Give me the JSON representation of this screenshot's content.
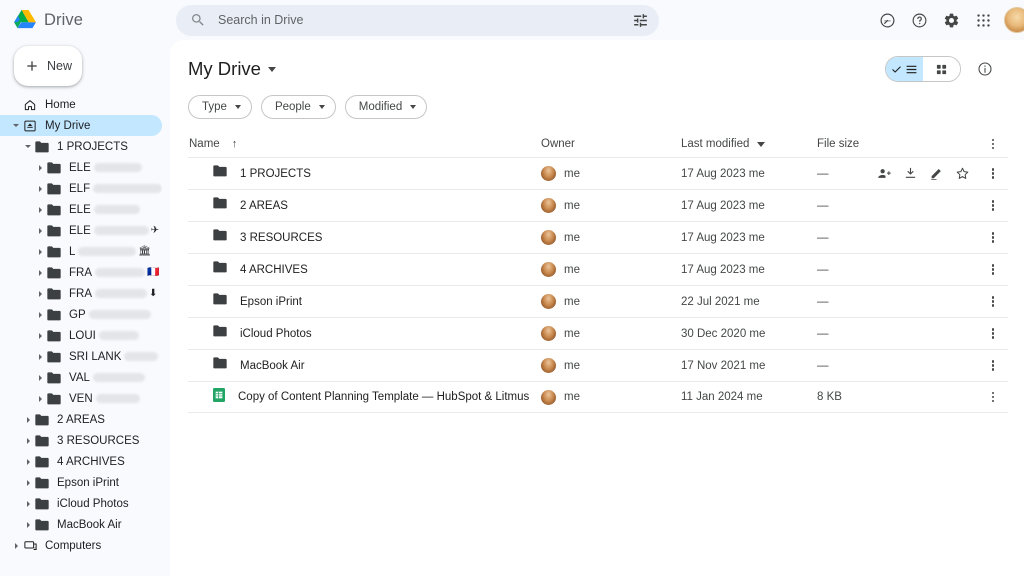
{
  "app": {
    "brand": "Drive",
    "logo_colors": [
      "#0da960",
      "#2684fc",
      "#ffc107"
    ]
  },
  "search": {
    "placeholder": "Search in Drive",
    "value": "",
    "tune_icon": "tune-icon",
    "icon": "search-icon"
  },
  "topbar_icons": [
    {
      "name": "activity-icon",
      "label": "Activity"
    },
    {
      "name": "help-icon",
      "label": "Support"
    },
    {
      "name": "settings-gear-icon",
      "label": "Settings"
    },
    {
      "name": "apps-grid-icon",
      "label": "Google apps"
    }
  ],
  "sidebar": {
    "new_button": "New",
    "items": [
      {
        "label": "Home",
        "icon": "home-icon",
        "depth": 0,
        "twisty": "none",
        "active": false
      },
      {
        "label": "My Drive",
        "icon": "my-drive-icon",
        "depth": 0,
        "twisty": "open",
        "active": true
      },
      {
        "label": "1 PROJECTS",
        "icon": "folder-icon",
        "depth": 1,
        "twisty": "open",
        "active": false
      },
      {
        "label": "ELE",
        "icon": "folder-icon",
        "depth": 2,
        "twisty": "closed",
        "active": false,
        "redact": 48
      },
      {
        "label": "ELF",
        "icon": "folder-icon",
        "depth": 2,
        "twisty": "closed",
        "active": false,
        "redact": 70
      },
      {
        "label": "ELE",
        "icon": "folder-icon",
        "depth": 2,
        "twisty": "closed",
        "active": false,
        "redact": 46
      },
      {
        "label": "ELE",
        "icon": "folder-icon",
        "depth": 2,
        "twisty": "closed",
        "active": false,
        "redact": 55,
        "emoji": "✈"
      },
      {
        "label": "L",
        "icon": "folder-icon",
        "depth": 2,
        "twisty": "closed",
        "active": false,
        "redact": 58,
        "emoji": "🏛"
      },
      {
        "label": "FRA",
        "icon": "folder-icon",
        "depth": 2,
        "twisty": "closed",
        "active": false,
        "redact": 50,
        "emoji": "🇫🇷"
      },
      {
        "label": "FRA",
        "icon": "folder-icon",
        "depth": 2,
        "twisty": "closed",
        "active": false,
        "redact": 52,
        "emoji": "⬇"
      },
      {
        "label": "GP",
        "icon": "folder-icon",
        "depth": 2,
        "twisty": "closed",
        "active": false,
        "redact": 62
      },
      {
        "label": "LOUI",
        "icon": "folder-icon",
        "depth": 2,
        "twisty": "closed",
        "active": false,
        "redact": 40
      },
      {
        "label": "SRI LANK",
        "icon": "folder-icon",
        "depth": 2,
        "twisty": "closed",
        "active": false,
        "redact": 34
      },
      {
        "label": "VAL",
        "icon": "folder-icon",
        "depth": 2,
        "twisty": "closed",
        "active": false,
        "redact": 52
      },
      {
        "label": "VEN",
        "icon": "folder-icon",
        "depth": 2,
        "twisty": "closed",
        "active": false,
        "redact": 44
      },
      {
        "label": "2 AREAS",
        "icon": "folder-icon",
        "depth": 1,
        "twisty": "closed",
        "active": false
      },
      {
        "label": "3 RESOURCES",
        "icon": "folder-icon",
        "depth": 1,
        "twisty": "closed",
        "active": false
      },
      {
        "label": "4 ARCHIVES",
        "icon": "folder-icon",
        "depth": 1,
        "twisty": "closed",
        "active": false
      },
      {
        "label": "Epson iPrint",
        "icon": "folder-icon",
        "depth": 1,
        "twisty": "closed",
        "active": false
      },
      {
        "label": "iCloud Photos",
        "icon": "folder-icon",
        "depth": 1,
        "twisty": "closed",
        "active": false
      },
      {
        "label": "MacBook Air",
        "icon": "folder-icon",
        "depth": 1,
        "twisty": "closed",
        "active": false
      },
      {
        "label": "Computers",
        "icon": "computers-icon",
        "depth": 0,
        "twisty": "closed",
        "active": false
      }
    ]
  },
  "main": {
    "title": "My Drive",
    "filters": [
      {
        "label": "Type",
        "name": "filter-type"
      },
      {
        "label": "People",
        "name": "filter-people"
      },
      {
        "label": "Modified",
        "name": "filter-modified"
      }
    ],
    "view": {
      "list_active": true,
      "list_name": "list-view-button",
      "grid_name": "grid-view-button",
      "info_name": "details-info-button"
    },
    "columns": {
      "name": "Name",
      "sort_indicator": "↑",
      "owner": "Owner",
      "last_modified": "Last modified",
      "file_size": "File size"
    },
    "rows": [
      {
        "name": "1 PROJECTS",
        "icon": "folder-icon",
        "owner": "me",
        "modified": "17 Aug 2023 me",
        "size": "—",
        "hover": true
      },
      {
        "name": "2 AREAS",
        "icon": "folder-icon",
        "owner": "me",
        "modified": "17 Aug 2023 me",
        "size": "—",
        "hover": false
      },
      {
        "name": "3 RESOURCES",
        "icon": "folder-icon",
        "owner": "me",
        "modified": "17 Aug 2023 me",
        "size": "—",
        "hover": false
      },
      {
        "name": "4 ARCHIVES",
        "icon": "folder-icon",
        "owner": "me",
        "modified": "17 Aug 2023 me",
        "size": "—",
        "hover": false
      },
      {
        "name": "Epson iPrint",
        "icon": "folder-icon",
        "owner": "me",
        "modified": "22 Jul 2021 me",
        "size": "—",
        "hover": false
      },
      {
        "name": "iCloud Photos",
        "icon": "folder-icon",
        "owner": "me",
        "modified": "30 Dec 2020 me",
        "size": "—",
        "hover": false
      },
      {
        "name": "MacBook Air",
        "icon": "folder-icon",
        "owner": "me",
        "modified": "17 Nov 2021 me",
        "size": "—",
        "hover": false
      },
      {
        "name": "Copy of Content Planning Template — HubSpot & Litmus",
        "icon": "google-sheets-icon",
        "owner": "me",
        "modified": "11 Jan 2024 me",
        "size": "8 KB",
        "hover": false
      }
    ],
    "row_actions": [
      {
        "name": "share-icon",
        "label": "Share"
      },
      {
        "name": "download-icon",
        "label": "Download"
      },
      {
        "name": "rename-pencil-icon",
        "label": "Rename"
      },
      {
        "name": "star-icon",
        "label": "Add to starred"
      }
    ]
  },
  "colors": {
    "accent": "#c2e7ff",
    "panel": "#ffffff",
    "page_bg": "#f8fafd",
    "search_bg": "#e9eef6",
    "sheets_green": "#23a566"
  }
}
